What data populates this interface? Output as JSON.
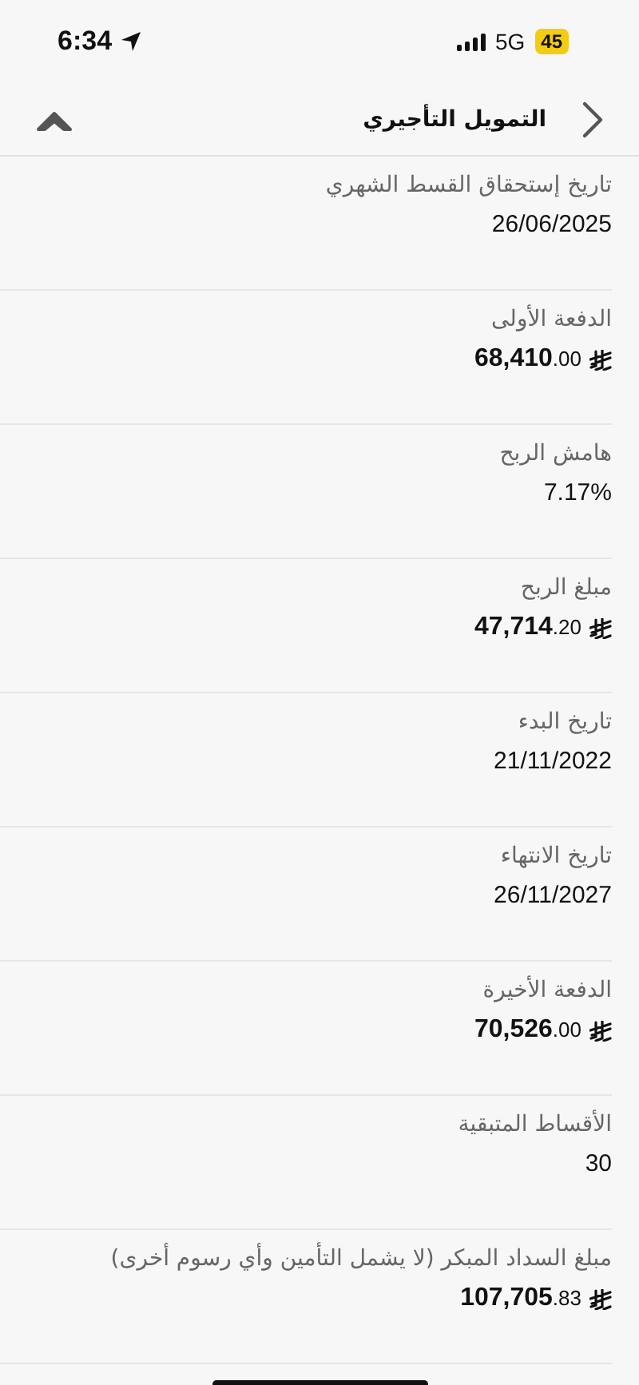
{
  "status_bar": {
    "time": "6:34",
    "network": "5G",
    "battery": "45"
  },
  "nav": {
    "title": "التمويل التأجيري"
  },
  "rows": [
    {
      "kind": "text",
      "label": "تاريخ إستحقاق القسط الشهري",
      "value": "26/06/2025"
    },
    {
      "kind": "amount",
      "label": "الدفعة الأولى",
      "value": "68,410",
      "decimals": ".00"
    },
    {
      "kind": "text",
      "label": "هامش الربح",
      "value": "7.17%"
    },
    {
      "kind": "amount",
      "label": "مبلغ الربح",
      "value": "47,714",
      "decimals": ".20"
    },
    {
      "kind": "text",
      "label": "تاريخ البدء",
      "value": "21/11/2022"
    },
    {
      "kind": "text",
      "label": "تاريخ الانتهاء",
      "value": "26/11/2027"
    },
    {
      "kind": "amount",
      "label": "الدفعة الأخيرة",
      "value": "70,526",
      "decimals": ".00"
    },
    {
      "kind": "text",
      "label": "الأقساط المتبقية",
      "value": "30"
    },
    {
      "kind": "amount",
      "label": "مبلغ السداد المبكر (لا يشمل التأمين وأي رسوم أخرى)",
      "value": "107,705",
      "decimals": ".83"
    }
  ]
}
